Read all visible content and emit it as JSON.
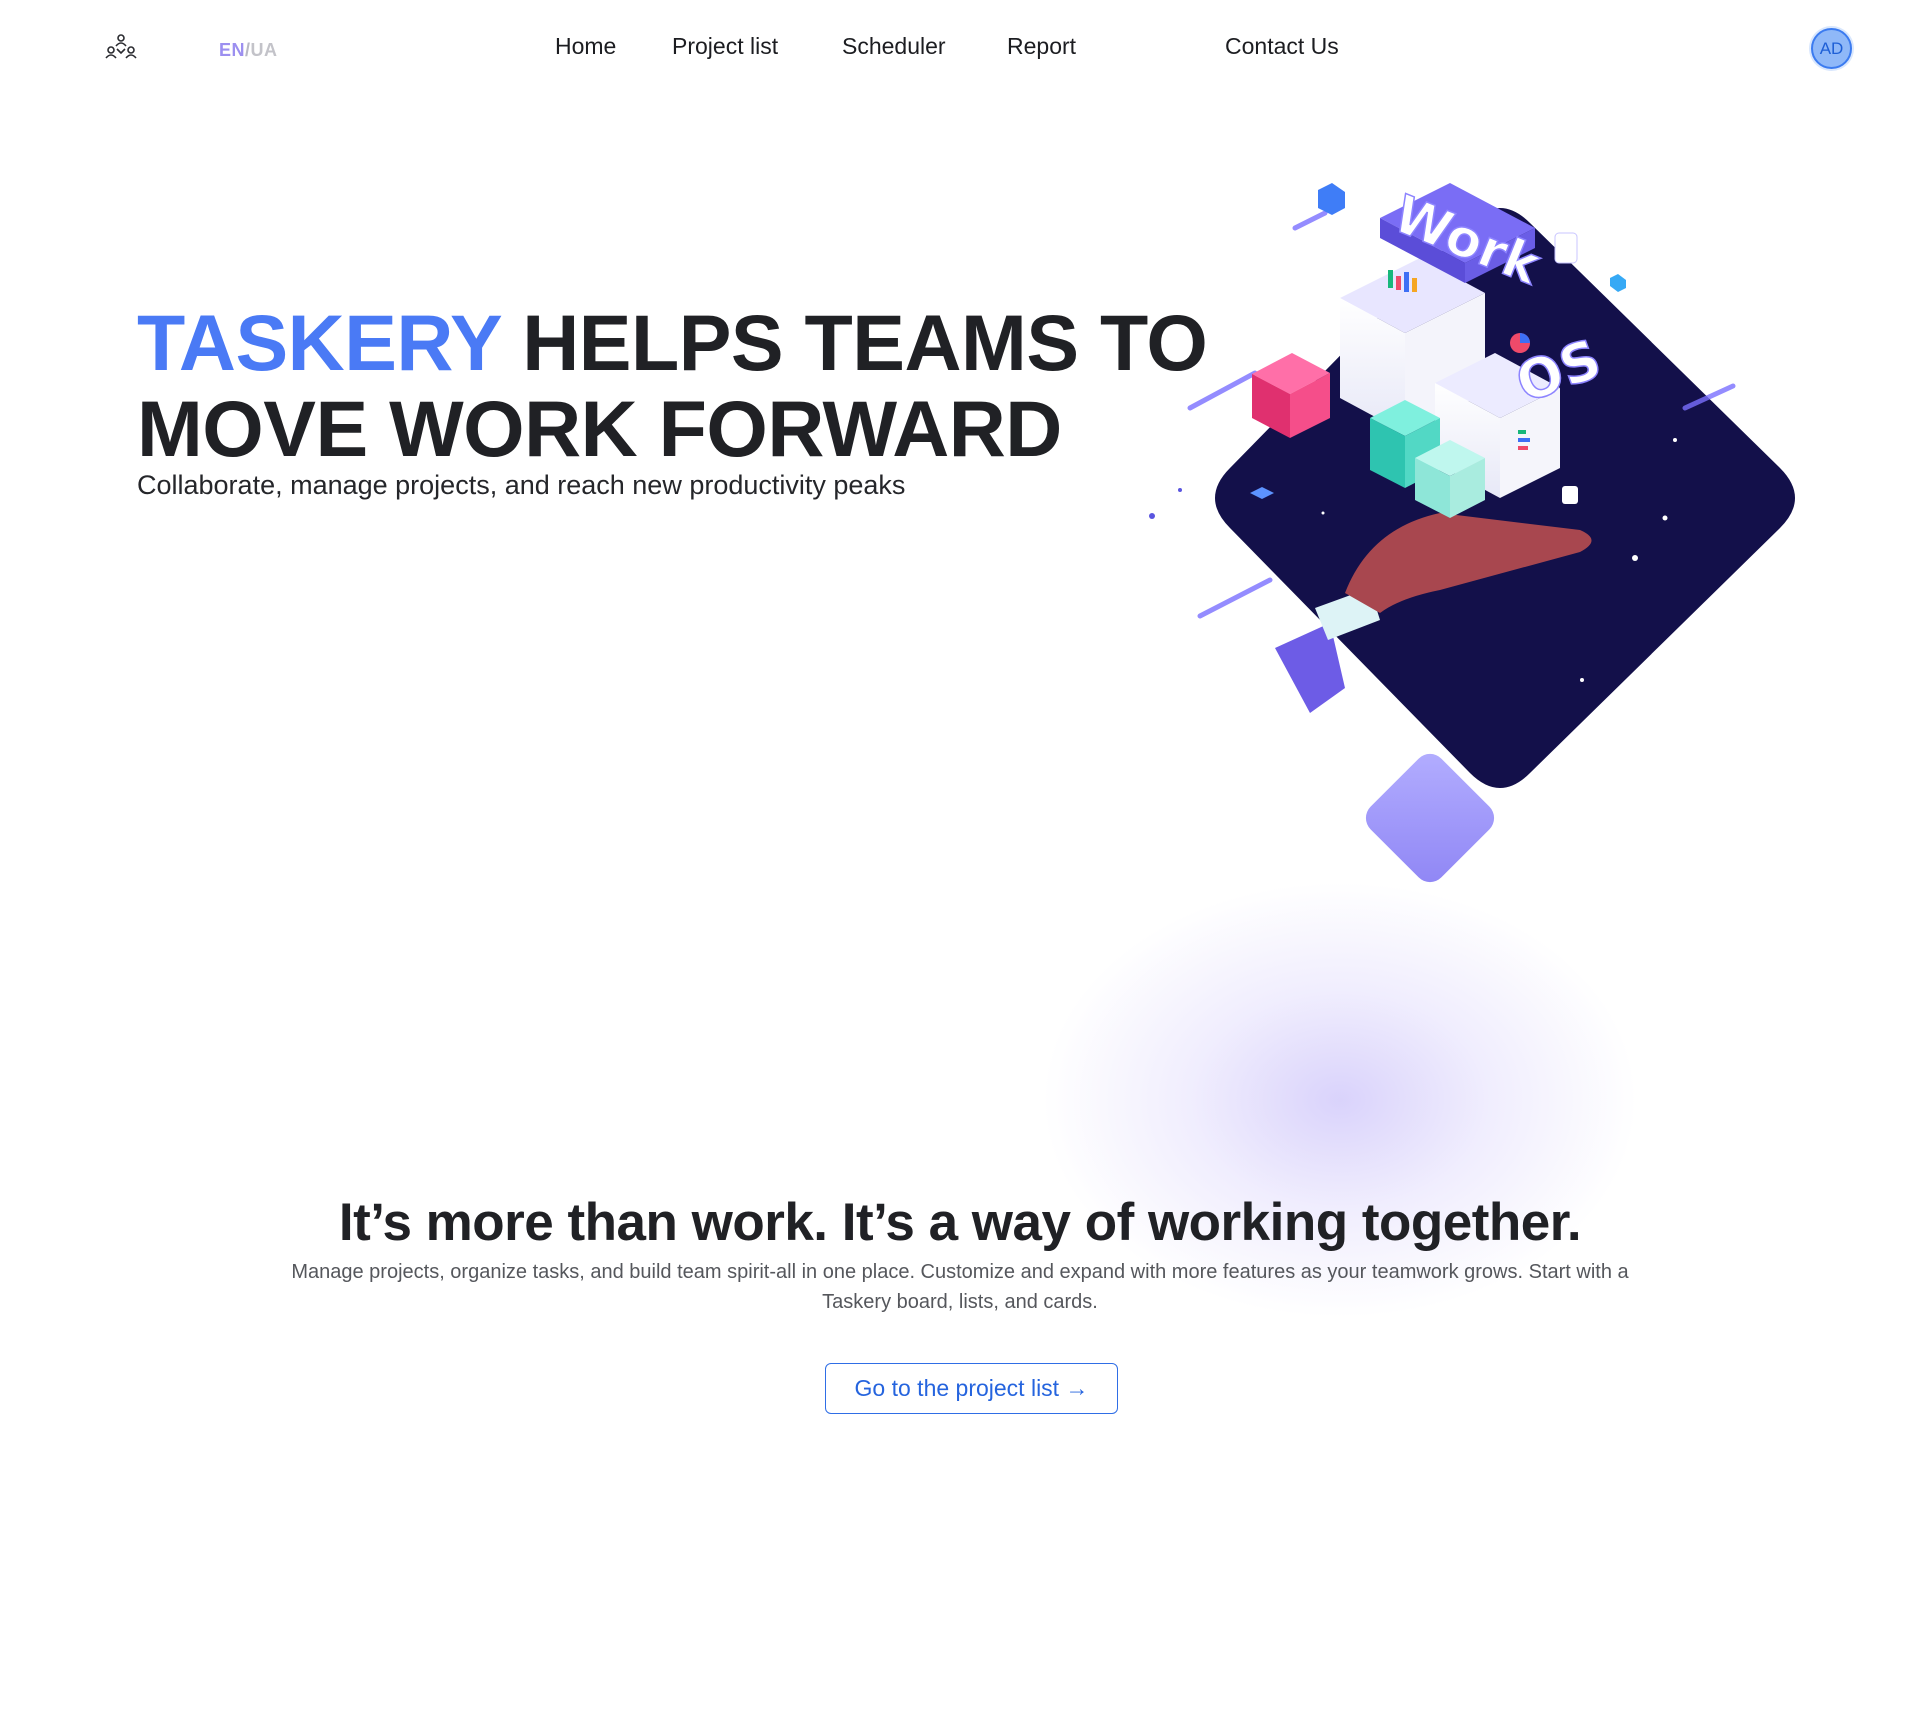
{
  "header": {
    "logo_icon": "team-icon",
    "lang": {
      "en": "EN",
      "separator": "/",
      "ua": "UA"
    },
    "nav": [
      {
        "label": "Home"
      },
      {
        "label": "Project list"
      },
      {
        "label": "Scheduler"
      },
      {
        "label": "Report"
      },
      {
        "label": "Contact Us"
      }
    ],
    "avatar": "AD"
  },
  "hero": {
    "brand": "TASKERY",
    "title_rest_line1": "HELPS TEAMS TO",
    "title_line2": "MOVE WORK FORWARD",
    "subtitle": "Collaborate, manage projects, and reach new productivity peaks",
    "illustration": {
      "word_top": "Work",
      "word_bottom": "OS"
    }
  },
  "section": {
    "title": "It’s more than work. It’s a way of working together.",
    "text": "Manage projects, organize tasks, and build team spirit-all in one place. Customize and expand with more features as your teamwork grows. Start with a Taskery board, lists, and cards.",
    "cta_label": "Go to the project list →"
  },
  "colors": {
    "brand_blue": "#4a7af5",
    "accent_purple": "#9c8ff0",
    "dark_navy": "#13104a",
    "button_blue": "#2f6ee6"
  }
}
